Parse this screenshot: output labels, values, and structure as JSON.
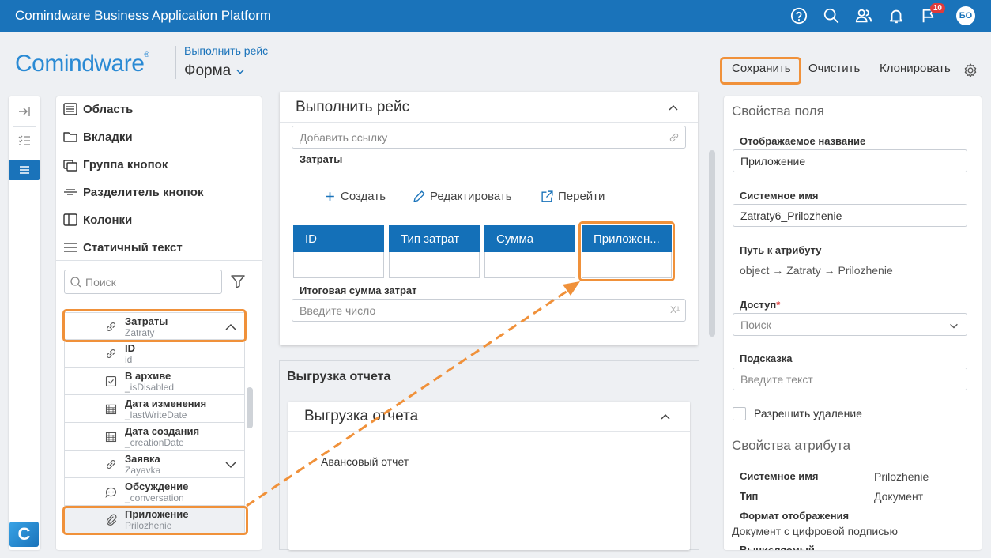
{
  "topbar": {
    "title": "Comindware Business Application Platform",
    "notification_count": "10",
    "avatar": "БО",
    "icons": [
      "help-icon",
      "search-icon",
      "users-icon",
      "bell-icon",
      "flag-icon"
    ]
  },
  "header": {
    "logo": "Comindware",
    "logo_mark": "®",
    "breadcrumb": "Выполнить рейс",
    "title": "Форма",
    "save": "Сохранить",
    "clear": "Очистить",
    "clone": "Клонировать"
  },
  "rail": {
    "logo": "C"
  },
  "palette": {
    "items": [
      "Область",
      "Вкладки",
      "Группа кнопок",
      "Разделитель кнопок",
      "Колонки",
      "Статичный текст"
    ],
    "search_placeholder": "Поиск",
    "tree": [
      {
        "name": "Затраты",
        "sys": "Zatraty"
      },
      {
        "name": "ID",
        "sys": "id"
      },
      {
        "name": "В архиве",
        "sys": "_isDisabled"
      },
      {
        "name": "Дата изменения",
        "sys": "_lastWriteDate"
      },
      {
        "name": "Дата создания",
        "sys": "_creationDate"
      },
      {
        "name": "Заявка",
        "sys": "Zayavka"
      },
      {
        "name": "Обсуждение",
        "sys": "_conversation"
      },
      {
        "name": "Приложение",
        "sys": "Prilozhenie"
      }
    ]
  },
  "center": {
    "card1_title": "Выполнить рейс",
    "link_placeholder": "Добавить ссылку",
    "table_label": "Затраты",
    "actions": [
      "Создать",
      "Редактировать",
      "Перейти"
    ],
    "columns": [
      "ID",
      "Тип затрат",
      "Сумма",
      "Приложен..."
    ],
    "total_label": "Итоговая сумма затрат",
    "number_placeholder": "Введите число",
    "number_icon": "X¹",
    "group_title": "Выгрузка отчета",
    "card2_title": "Выгрузка отчета",
    "card2_text": "Авансовый отчет"
  },
  "props": {
    "title": "Свойства поля",
    "display_name_label": "Отображаемое название",
    "display_name_value": "Приложение",
    "system_name_label": "Системное имя",
    "system_name_value": "Zatraty6_Prilozhenie",
    "path_label": "Путь к атрибуту",
    "path_value": "object → Zatraty → Prilozhenie",
    "access_label": "Доступ",
    "access_required": "*",
    "access_placeholder": "Поиск",
    "hint_label": "Подсказка",
    "hint_placeholder": "Введите текст",
    "allow_delete": "Разрешить удаление",
    "attr_title": "Свойства атрибута",
    "attr_sysname_label": "Системное имя",
    "attr_sysname_value": "Prilozhenie",
    "attr_type_label": "Тип",
    "attr_type_value": "Документ",
    "attr_format_label": "Формат отображения",
    "attr_format_value": "Документ с цифровой подписью",
    "attr_calc_label": "Вычисляемый"
  },
  "colors": {
    "accent": "#1a73ba",
    "highlight": "#f0913a",
    "header_cell": "#1470b8"
  }
}
